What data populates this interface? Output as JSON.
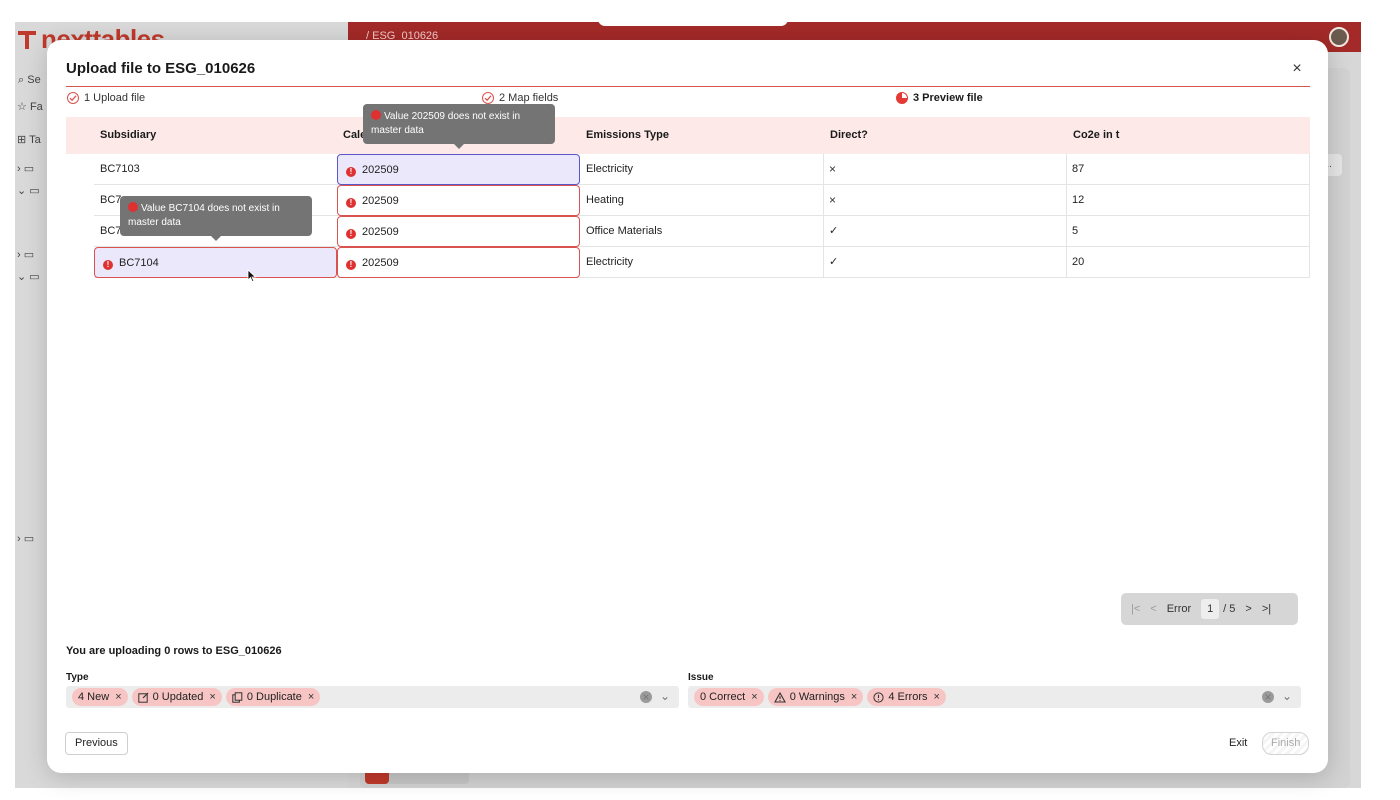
{
  "app": {
    "brand": "nexttables",
    "breadcrumb": "/ ESG_010626",
    "side_search": "Se",
    "side_favorites": "Fa",
    "side_tables": "Ta",
    "chip_label": "d..."
  },
  "modal": {
    "title": "Upload file to ESG_010626",
    "close": "×"
  },
  "steps": [
    {
      "label": "1 Upload file",
      "state": "done"
    },
    {
      "label": "2 Map fields",
      "state": "done"
    },
    {
      "label": "3 Preview file",
      "state": "active"
    }
  ],
  "table": {
    "columns": [
      "Subsidiary",
      "Cale",
      "Emissions Type",
      "Direct?",
      "Co2e in t"
    ],
    "rows": [
      {
        "subsidiary": "BC7103",
        "calendar": "202509",
        "emissions_type": "Electricity",
        "direct": "×",
        "co2e": "87"
      },
      {
        "subsidiary": "BC7",
        "calendar": "202509",
        "emissions_type": "Heating",
        "direct": "×",
        "co2e": "12"
      },
      {
        "subsidiary": "BC7",
        "calendar": "202509",
        "emissions_type": "Office Materials",
        "direct": "✓",
        "co2e": "5"
      },
      {
        "subsidiary": "BC7104",
        "calendar": "202509",
        "emissions_type": "Electricity",
        "direct": "✓",
        "co2e": "20"
      }
    ]
  },
  "tooltips": {
    "calendar": "Value 202509 does not exist in master data",
    "subsidiary": "Value BC7104 does not exist in master data"
  },
  "pager": {
    "label": "Error",
    "current": "1",
    "total": "/ 5",
    "first": "|<",
    "prev": "<",
    "next": ">",
    "last": ">|"
  },
  "summary": "You are uploading 0 rows to ESG_010626",
  "filters": {
    "type_label": "Type",
    "type_chips": [
      "4 New",
      "0 Updated",
      "0 Duplicate"
    ],
    "issue_label": "Issue",
    "issue_chips": [
      "0 Correct",
      "0 Warnings",
      "4 Errors"
    ]
  },
  "footer": {
    "previous": "Previous",
    "exit": "Exit",
    "finish": "Finish"
  },
  "colors": {
    "accent": "#d9534f",
    "error": "#e03131",
    "header_bg": "#fdeae8",
    "selection": "#ebe8fb",
    "chip": "#f7c6c4"
  }
}
